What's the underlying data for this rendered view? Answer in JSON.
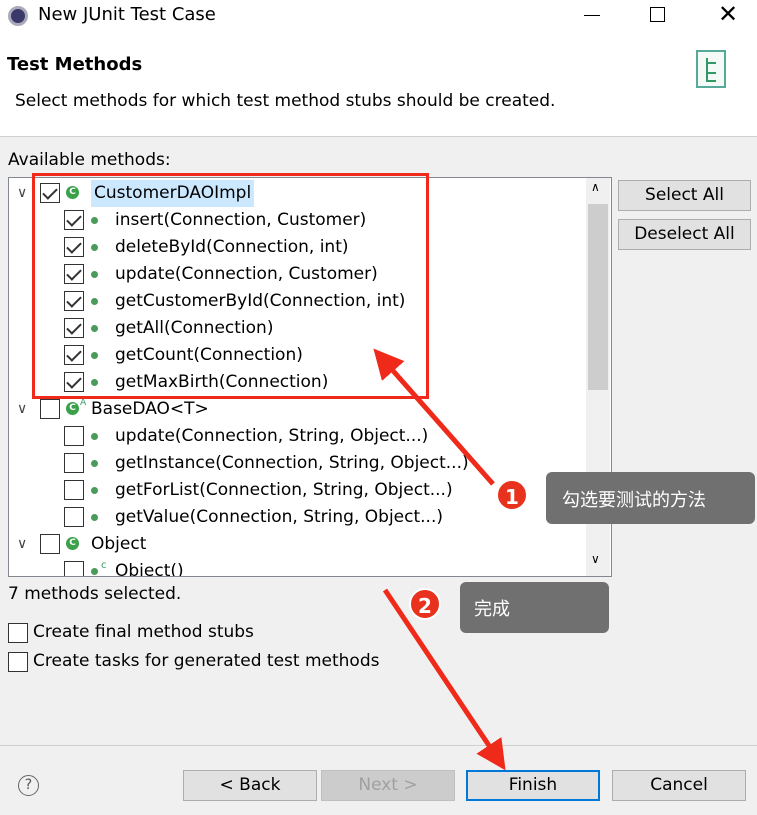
{
  "window": {
    "title": "New JUnit Test Case",
    "minimize_icon": "minimize-icon",
    "maximize_icon": "maximize-icon",
    "close_icon": "close-icon"
  },
  "header": {
    "title": "Test Methods",
    "description": "Select methods for which test method stubs should be created."
  },
  "available_label": "Available methods:",
  "tree": [
    {
      "label": "CustomerDAOImpl",
      "level": 0,
      "checked": true,
      "type": "class",
      "selected": true
    },
    {
      "label": "insert(Connection, Customer)",
      "level": 1,
      "checked": true
    },
    {
      "label": "deleteById(Connection, int)",
      "level": 1,
      "checked": true
    },
    {
      "label": "update(Connection, Customer)",
      "level": 1,
      "checked": true
    },
    {
      "label": "getCustomerById(Connection, int)",
      "level": 1,
      "checked": true
    },
    {
      "label": "getAll(Connection)",
      "level": 1,
      "checked": true
    },
    {
      "label": "getCount(Connection)",
      "level": 1,
      "checked": true
    },
    {
      "label": "getMaxBirth(Connection)",
      "level": 1,
      "checked": true
    },
    {
      "label": "BaseDAO<T>",
      "level": 0,
      "checked": false,
      "type": "abstract-class"
    },
    {
      "label": "update(Connection, String, Object...)",
      "level": 1,
      "checked": false
    },
    {
      "label": "getInstance(Connection, String, Object...)",
      "level": 1,
      "checked": false
    },
    {
      "label": "getForList(Connection, String, Object...)",
      "level": 1,
      "checked": false
    },
    {
      "label": "getValue(Connection, String, Object...)",
      "level": 1,
      "checked": false
    },
    {
      "label": "Object",
      "level": 0,
      "checked": false,
      "type": "class"
    },
    {
      "label": "Object()",
      "level": 1,
      "checked": false,
      "type": "constructor"
    }
  ],
  "buttons": {
    "select_all": "Select All",
    "deselect_all": "Deselect All",
    "back": "< Back",
    "next": "Next >",
    "finish": "Finish",
    "cancel": "Cancel"
  },
  "status": "7 methods selected.",
  "options": [
    {
      "label": "Create final method stubs",
      "checked": false
    },
    {
      "label": "Create tasks for generated test methods",
      "checked": false
    }
  ],
  "annotations": [
    {
      "number": "1",
      "text": "勾选要测试的方法"
    },
    {
      "number": "2",
      "text": "完成"
    }
  ],
  "colors": {
    "annotation": "#e8321e",
    "callout": "#707070",
    "selection": "#cce8ff"
  }
}
